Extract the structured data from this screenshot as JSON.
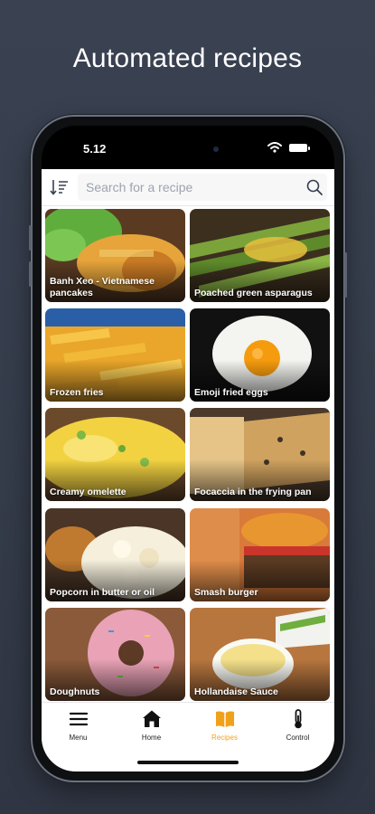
{
  "headline": "Automated recipes",
  "status_bar": {
    "time": "5.12"
  },
  "search": {
    "placeholder": "Search for a recipe",
    "value": ""
  },
  "icons": {
    "sort": "sort-icon",
    "search": "search-icon",
    "menu": "hamburger-icon",
    "home": "home-icon",
    "recipes": "book-icon",
    "control": "thermometer-icon"
  },
  "recipes": [
    {
      "name": "Banh Xeo - Vietnamese pancakes"
    },
    {
      "name": "Poached green asparagus"
    },
    {
      "name": "Frozen fries"
    },
    {
      "name": "Emoji fried eggs"
    },
    {
      "name": "Creamy omelette"
    },
    {
      "name": "Focaccia in the frying pan"
    },
    {
      "name": "Popcorn in butter or oil"
    },
    {
      "name": "Smash burger"
    },
    {
      "name": "Doughnuts"
    },
    {
      "name": "Hollandaise Sauce"
    }
  ],
  "nav": {
    "menu": "Menu",
    "home": "Home",
    "recipes": "Recipes",
    "control": "Control",
    "active": "recipes"
  },
  "colors": {
    "accent": "#f0a11a",
    "background": "#373e4c"
  }
}
